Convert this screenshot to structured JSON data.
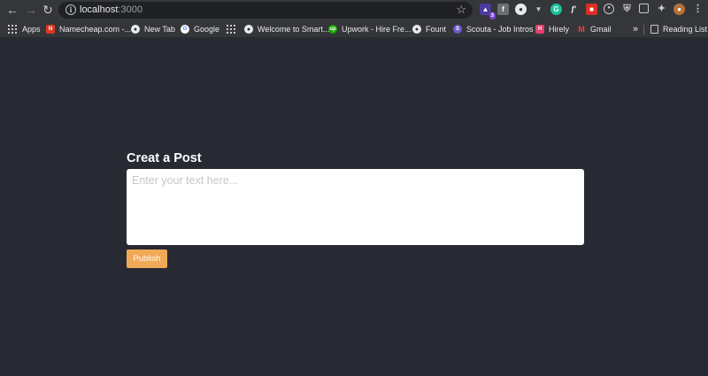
{
  "browser": {
    "url_host": "localhost",
    "url_port": ":3000",
    "extension_badge": "3",
    "bookmarks": [
      {
        "label": "Apps",
        "icon": "apps-grid-icon"
      },
      {
        "label": "Namecheap.com -...",
        "icon": "namecheap-icon",
        "color": "#de3723"
      },
      {
        "label": "New Tab",
        "icon": "globe-icon"
      },
      {
        "label": "Google",
        "icon": "google-icon"
      },
      {
        "label": "",
        "icon": "grid-icon"
      },
      {
        "label": "Welcome to Smart...",
        "icon": "globe-icon"
      },
      {
        "label": "Upwork - Hire Fre...",
        "icon": "upwork-icon",
        "color": "#14a800"
      },
      {
        "label": "Fount",
        "icon": "globe-icon"
      },
      {
        "label": "Scouta - Job Intros",
        "icon": "scouta-icon",
        "color": "#6d5bd0"
      },
      {
        "label": "Hirely",
        "icon": "hirely-icon",
        "color": "#e83e6c"
      },
      {
        "label": "Gmail",
        "icon": "gmail-icon",
        "color": "#ea4335"
      }
    ],
    "overflow_label": "»",
    "reading_list_label": "Reading List"
  },
  "page": {
    "title": "Creat a Post",
    "input_value": "",
    "input_placeholder": "Enter your text here...",
    "publish_label": "Publish"
  },
  "colors": {
    "background": "#282a33",
    "publish_button": "#f0a956",
    "input_background": "#ffffff"
  }
}
